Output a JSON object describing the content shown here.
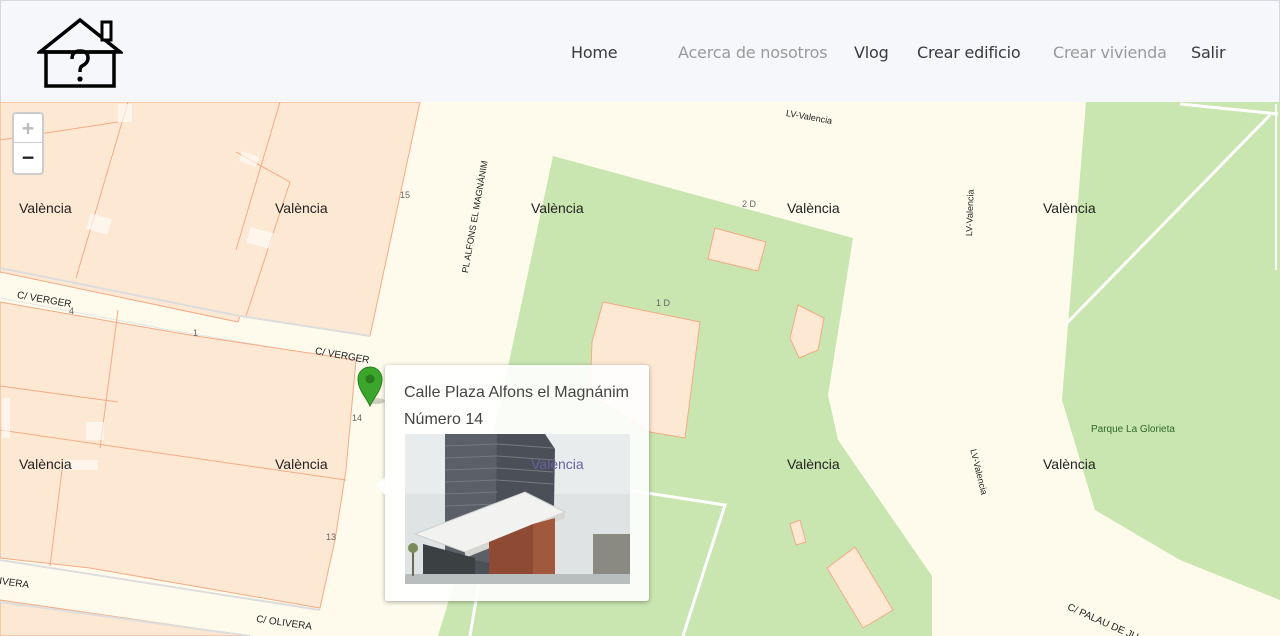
{
  "nav": {
    "items": [
      {
        "label": "Home",
        "state": "active"
      },
      {
        "label": "Acerca de nosotros",
        "state": "muted"
      },
      {
        "label": "Vlog",
        "state": "normal"
      },
      {
        "label": "Crear edificio",
        "state": "normal"
      },
      {
        "label": "Crear vivienda",
        "state": "muted"
      },
      {
        "label": "Salir",
        "state": "normal"
      }
    ]
  },
  "map": {
    "zoom_in": "+",
    "zoom_out": "−",
    "labels": {
      "city": "València",
      "street_verger": "C/ VERGER",
      "street_olivera": "C/ OLIVERA",
      "street_olivera_partial": "IVERA",
      "street_palau": "C/ PALAU DE JU",
      "plaza": "PL ALFONS EL MAGNÀNIM",
      "road_lv": "LV-Valencia",
      "park": "Parque La Glorieta",
      "num_15": "15",
      "num_4": "4",
      "num_1": "1",
      "num_14": "14",
      "num_13": "13",
      "num_2d": "2 D",
      "num_1d": "1 D"
    },
    "colors": {
      "background": "#fefbec",
      "parcel_fill": "#fde8d3",
      "parcel_stroke": "#f3ab85",
      "park": "#c9e5b0",
      "marker": "#3ca62c"
    }
  },
  "popup": {
    "address": "Calle Plaza Alfons el Magnánim",
    "number": "Número 14",
    "photo_icon": "building-photo"
  }
}
